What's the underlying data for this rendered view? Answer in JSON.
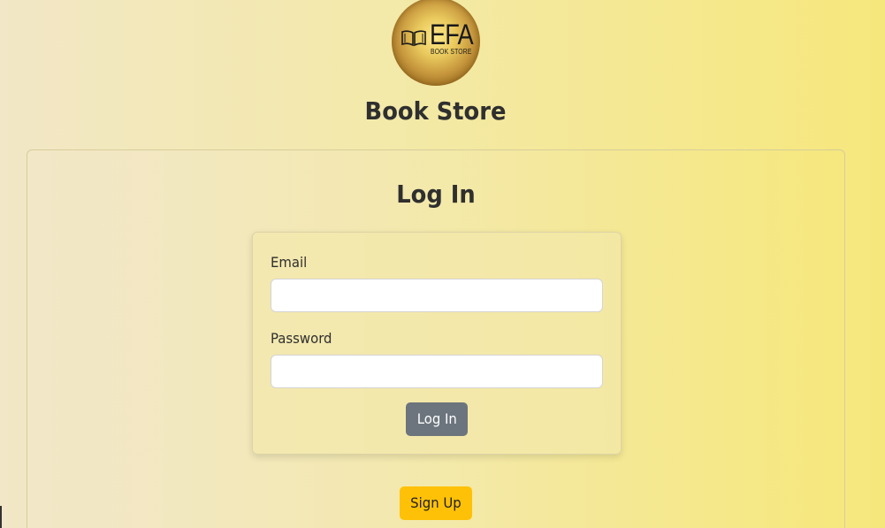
{
  "header": {
    "logo_text": "EFA",
    "logo_subtext": "BOOK STORE",
    "site_title": "Book Store"
  },
  "login": {
    "title": "Log In",
    "email_label": "Email",
    "email_value": "",
    "password_label": "Password",
    "password_value": "",
    "submit_label": "Log In"
  },
  "signup": {
    "label": "Sign Up"
  },
  "colors": {
    "login_button": "#6c757d",
    "signup_button": "#ffc107",
    "background_start": "#f2e7c6",
    "background_end": "#f6e77c"
  }
}
